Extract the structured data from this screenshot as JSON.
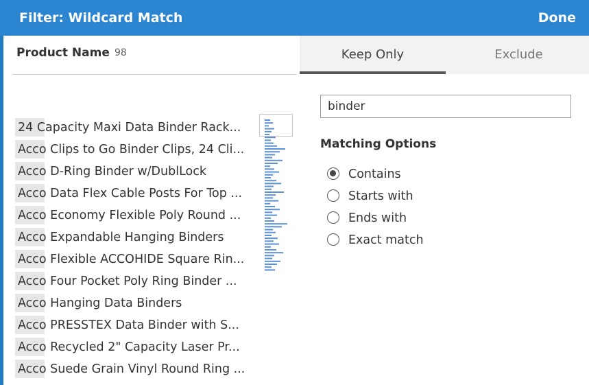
{
  "dialog": {
    "title": "Filter: Wildcard Match",
    "done_label": "Done"
  },
  "field": {
    "name": "Product Name",
    "count": "98"
  },
  "values": [
    "24 Capacity Maxi Data Binder Rack...",
    "Acco Clips to Go Binder Clips, 24 Cli...",
    "Acco D-Ring Binder w/DublLock",
    "Acco Data Flex Cable Posts For Top ...",
    "Acco Economy Flexible Poly Round ...",
    "Acco Expandable Hanging Binders",
    "Acco Flexible ACCOHIDE Square Rin...",
    "Acco Four Pocket Poly Ring Binder ...",
    "Acco Hanging Data Binders",
    "Acco PRESSTEX Data Binder with S...",
    "Acco Recycled 2\" Capacity Laser Pr...",
    "Acco Suede Grain Vinyl Round Ring ..."
  ],
  "histogram_color": "#5b8fd6",
  "tabs": {
    "keep_only": "Keep Only",
    "exclude": "Exclude",
    "active": "keep_only"
  },
  "search": {
    "value": "binder",
    "placeholder": ""
  },
  "matching": {
    "label": "Matching Options",
    "options": [
      "Contains",
      "Starts with",
      "Ends with",
      "Exact match"
    ],
    "selected": "Contains"
  },
  "colors": {
    "titlebar": "#2b85d0",
    "accent_border": "#1f7bc4"
  }
}
